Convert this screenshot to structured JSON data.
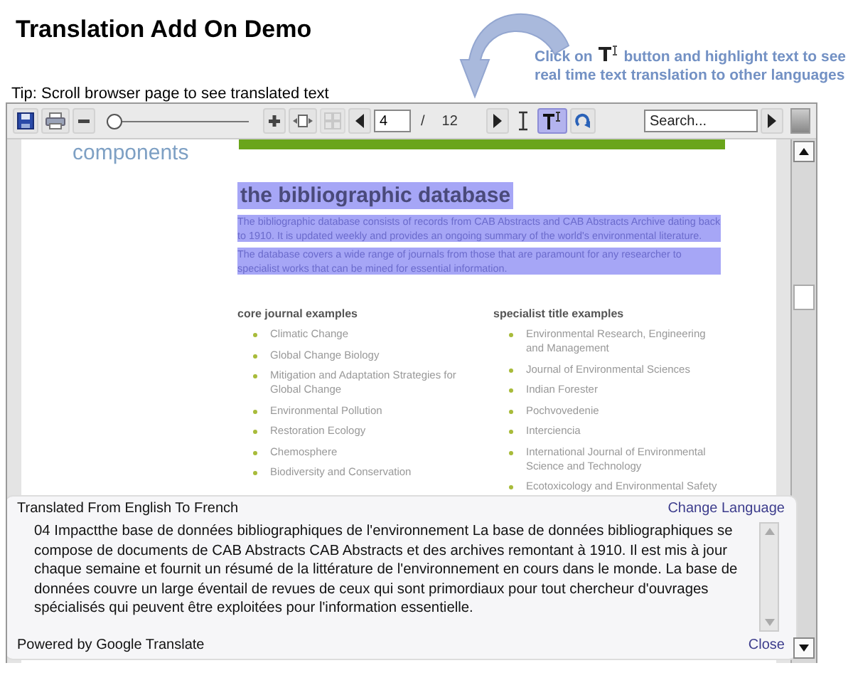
{
  "page_title": "Translation Add On Demo",
  "callout": {
    "before": "Click on",
    "after": "button and highlight text to see",
    "line2": "real time text translation to other languages"
  },
  "tip": "Tip: Scroll browser page to see translated text",
  "toolbar": {
    "zoom": {
      "level": 0.05
    },
    "page_field": {
      "value": "4"
    },
    "page_separator": "/",
    "page_count": "12",
    "tools": [
      {
        "kind": "select",
        "selected": false
      },
      {
        "kind": "translate",
        "selected": true
      }
    ],
    "search": {
      "placeholder": "Search..."
    }
  },
  "document": {
    "section_heading": "components",
    "heading": {
      "text": "the bibliographic database",
      "highlighted": true
    },
    "paragraphs": [
      {
        "text": "The bibliographic database consists of records from CAB Abstracts and CAB Abstracts Archive dating back to 1910. It is updated weekly and provides an ongoing summary of the world's environmental literature.",
        "highlighted": true
      },
      {
        "text": "The database covers a wide range of journals from those that are paramount for any researcher to specialist works that can be mined for essential information.",
        "highlighted": true
      }
    ],
    "columns": [
      {
        "title": "core journal examples",
        "items": [
          "Climatic Change",
          "Global Change Biology",
          "Mitigation and Adaptation Strategies for Global Change",
          "Environmental Pollution",
          "Restoration Ecology",
          "Chemosphere",
          "Biodiversity and Conservation"
        ]
      },
      {
        "title": "specialist title examples",
        "items": [
          "Environmental Research, Engineering and Management",
          "Journal of Environmental Sciences",
          "Indian Forester",
          "Pochvovedenie",
          "Interciencia",
          "International Journal of Environmental Science and Technology",
          "Ecotoxicology and Environmental Safety"
        ]
      }
    ]
  },
  "translation_panel": {
    "heading": "Translated From English To French",
    "change_language": "Change Language",
    "text": "04 Impactthe base de données bibliographiques de l'environnement La base de données bibliographiques se compose de documents de CAB Abstracts CAB Abstracts et des archives remontant à 1910. Il est mis à jour chaque semaine et fournit un résumé de la littérature de l'environnement en cours dans le monde. La base de données couvre un large éventail de revues de ceux qui sont primordiaux pour tout chercheur d'ouvrages spécialisés qui peuvent être exploitées pour l'information essentielle.",
    "credit": "Powered by Google Translate",
    "close": "Close"
  }
}
